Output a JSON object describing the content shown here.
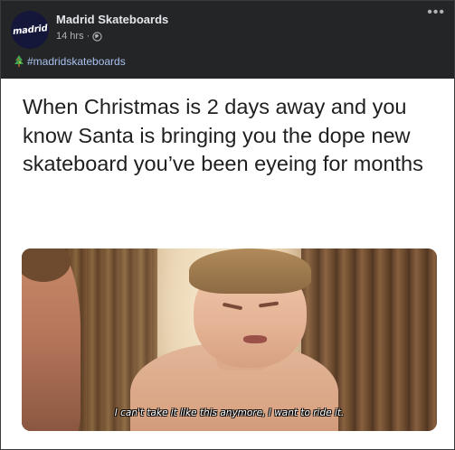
{
  "post": {
    "page_name": "Madrid Skateboards",
    "avatar_text": "madrid",
    "timestamp": "14 hrs",
    "separator": "·",
    "audience_icon": "globe-icon",
    "more_icon": "more-options-icon",
    "caption_icon": "christmas-tree-icon",
    "hashtag": "#madridskateboards"
  },
  "meme": {
    "text": "When Christmas is 2 days away and you know Santa is bringing you the dope new skateboard you’ve been eyeing for months",
    "subtitle": "I can't take it like this anymore, I want to ride it."
  },
  "colors": {
    "background": "#242526",
    "link": "#a9c1f0",
    "text_primary": "#e4e6eb",
    "text_secondary": "#b0b3b8",
    "avatar_bg": "#14163a"
  }
}
